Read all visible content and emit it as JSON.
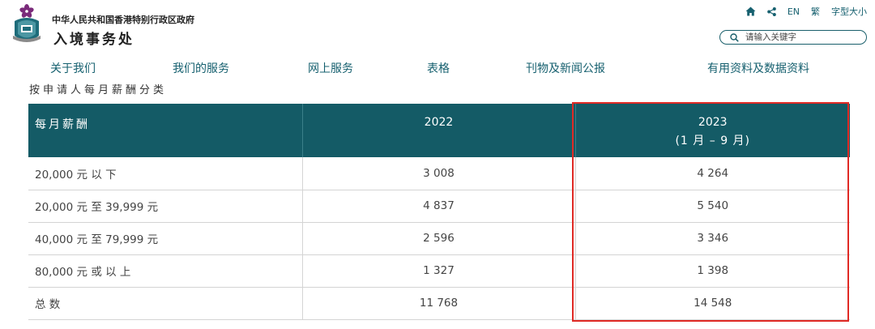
{
  "header": {
    "gov_name": "中华人民共和国香港特别行政区政府",
    "dept_name": "入境事务处",
    "logo_icon": "hksar-emblem-icon"
  },
  "utils": {
    "home_icon": "home-icon",
    "share_icon": "share-icon",
    "lang_en": "EN",
    "lang_tc": "繁",
    "font_size": "字型大小"
  },
  "search": {
    "placeholder": "请输入关键字",
    "icon": "search-icon"
  },
  "nav": {
    "items": [
      {
        "label": "关于我们"
      },
      {
        "label": "我们的服务"
      },
      {
        "label": "网上服务"
      },
      {
        "label": "表格"
      },
      {
        "label": "刊物及新闻公报"
      },
      {
        "label": "有用资料及数据资料"
      }
    ]
  },
  "subtitle": "按申请人每月薪酬分类",
  "table": {
    "headers": {
      "col1": "每月薪酬",
      "col2": "2022",
      "col3_line1": "2023",
      "col3_line2": "(1 月 – 9 月)"
    },
    "rows": [
      {
        "category": "20,000 元 以 下",
        "y2022": "3 008",
        "y2023": "4 264"
      },
      {
        "category": "20,000 元 至 39,999 元",
        "y2022": "4 837",
        "y2023": "5 540"
      },
      {
        "category": "40,000 元 至 79,999 元",
        "y2022": "2 596",
        "y2023": "3 346"
      },
      {
        "category": "80,000 元 或 以 上",
        "y2022": "1 327",
        "y2023": "1 398"
      },
      {
        "category": "总 数",
        "y2022": "11 768",
        "y2023": "14 548"
      }
    ]
  },
  "colors": {
    "header_bg": "#145b66",
    "accent": "#16606f",
    "highlight_border": "#e02a25"
  }
}
